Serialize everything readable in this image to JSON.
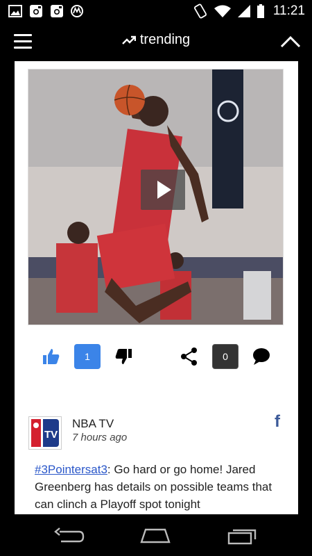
{
  "status_bar": {
    "time": "11:21",
    "left_icons": [
      "image-icon",
      "instagram-icon",
      "instagram-icon",
      "motorola-icon"
    ],
    "right_icons": [
      "rotate-icon",
      "wifi-icon",
      "signal-icon",
      "battery-icon"
    ]
  },
  "app_bar": {
    "title": "trending",
    "title_icon": "trending-up-icon",
    "menu_icon": "menu-icon",
    "collapse_icon": "chevron-up-icon"
  },
  "card1": {
    "video_icon": "play-icon",
    "like_count": "1",
    "share_count": "0",
    "accent_color": "#3b84e8"
  },
  "card2": {
    "source_name": "NBA TV",
    "time_ago": "7 hours ago",
    "avatar_label": "TV",
    "network_icon": "f",
    "hashtag": "#3Pointersat3",
    "post_body": ": Go hard or go home! Jared Greenberg has details on possible teams that can clinch a Playoff spot tonight",
    "link_color": "#2a57c9"
  },
  "nav_bar": {
    "buttons": [
      "back-icon",
      "home-icon",
      "recent-apps-icon"
    ]
  }
}
